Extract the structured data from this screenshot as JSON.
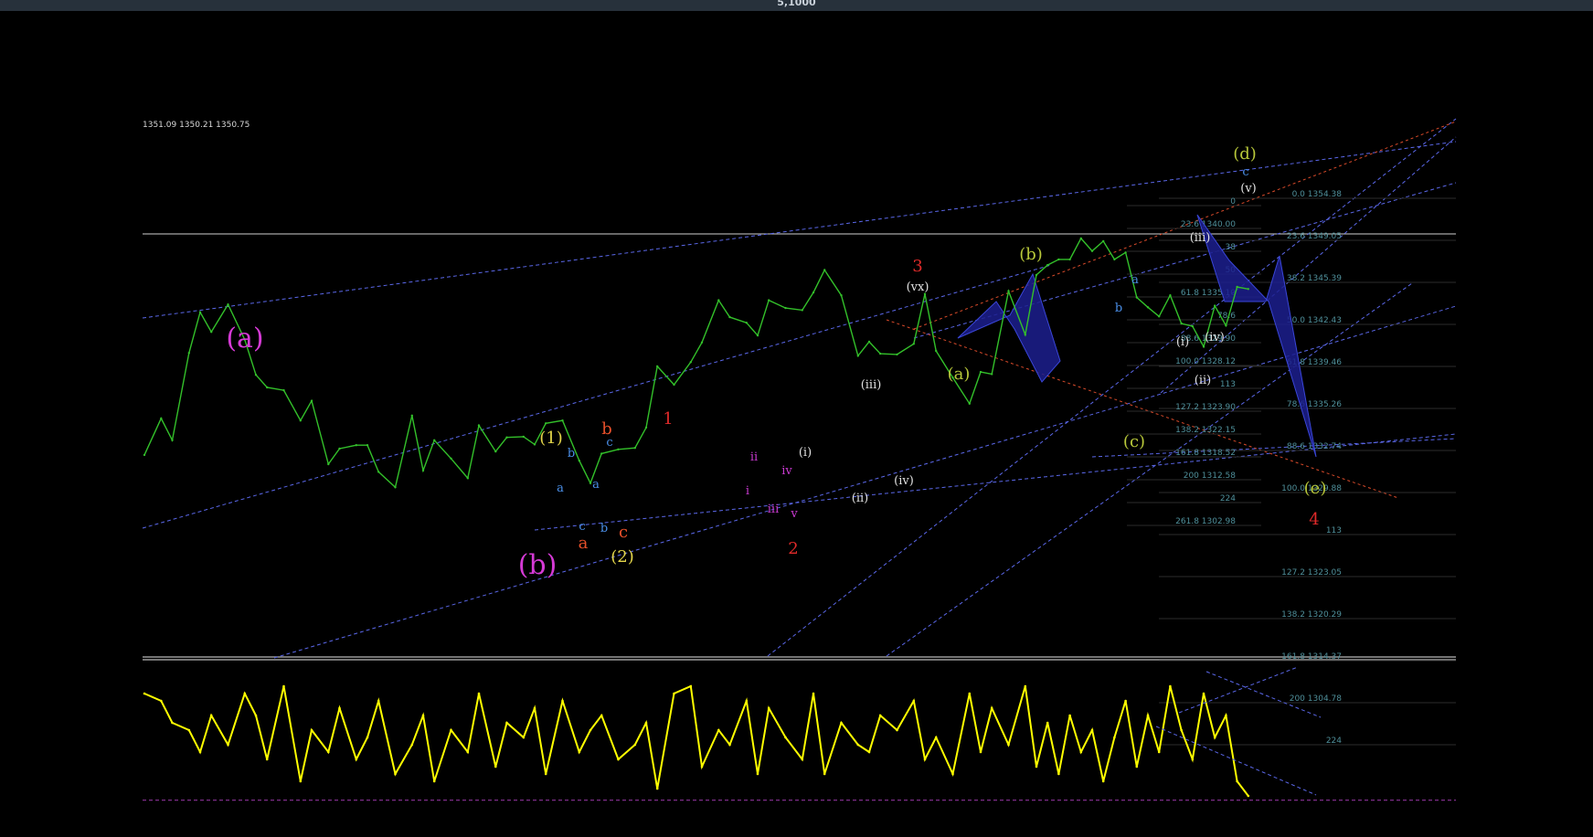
{
  "window": {
    "title": "5,1000"
  },
  "chart_data": [
    {
      "type": "line",
      "title": "",
      "ohlc_readout": "1351.09 1350.21 1350.75",
      "colors": {
        "price": "#33c02a",
        "background": "#000000",
        "channel": "#5a67e8",
        "fib_label": "#4f8f9a"
      },
      "x_index_range": [
        0,
        200
      ],
      "ylim": [
        1296,
        1372
      ],
      "series": [
        {
          "x": [
            0,
            3,
            5,
            8,
            10,
            12,
            15,
            18,
            20,
            22,
            25,
            28,
            30,
            33,
            35,
            38,
            40,
            42,
            45,
            48,
            50,
            52,
            55,
            58,
            60,
            63,
            65,
            68,
            70,
            72,
            75,
            78,
            80,
            82,
            85,
            88,
            90,
            92,
            95,
            98,
            100,
            103,
            105,
            108,
            110,
            112,
            115,
            118,
            120,
            122,
            125,
            128,
            130,
            132,
            135,
            138,
            140,
            142,
            145,
            148,
            150,
            152,
            155,
            158,
            160,
            162,
            164,
            166,
            168,
            170,
            172,
            174,
            176,
            178,
            180,
            182,
            184,
            186,
            188,
            190,
            192,
            194,
            196,
            198
          ],
          "values": [
            1324.2,
            1329.4,
            1326.3,
            1338.7,
            1344.5,
            1341.7,
            1345.6,
            1340.6,
            1335.6,
            1333.8,
            1333.4,
            1329.1,
            1331.9,
            1322.9,
            1325.1,
            1325.6,
            1325.6,
            1321.8,
            1319.6,
            1329.8,
            1322.0,
            1326.3,
            1323.7,
            1320.9,
            1328.4,
            1324.7,
            1326.7,
            1326.8,
            1325.7,
            1328.7,
            1329.1,
            1323.4,
            1320.2,
            1324.4,
            1325.0,
            1325.2,
            1328.1,
            1336.8,
            1334.2,
            1337.4,
            1340.2,
            1346.2,
            1343.8,
            1343.0,
            1341.2,
            1346.2,
            1345.1,
            1344.8,
            1347.3,
            1350.5,
            1346.9,
            1338.3,
            1340.3,
            1338.6,
            1338.5,
            1340.0,
            1347.1,
            1339.0,
            1335.2,
            1331.5,
            1336.0,
            1335.7,
            1347.5,
            1341.3,
            1349.8,
            1351.2,
            1352.0,
            1352.0,
            1355.0,
            1353.2,
            1354.6,
            1352.0,
            1353.0,
            1346.6,
            1345.2,
            1343.9,
            1346.9,
            1342.9,
            1342.5,
            1339.6,
            1345.4,
            1342.6,
            1348.1,
            1347.8
          ]
        }
      ],
      "fib_levels": [
        "0.0 1354.38",
        "23.6 1349.05",
        "38.2 1345.39",
        "50.0 1342.43",
        "61.8 1339.46",
        "78.6 1335.26",
        "88.6 1332.74",
        "100.0 1329.88",
        "113",
        "127.2 1323.05",
        "138.2 1320.29",
        "161.8 1314.37",
        "200 1304.78",
        "224",
        "0",
        "23.6 1340.00",
        "38",
        "50",
        "61.8 1335.10",
        "78.6",
        "88.6 1329.90",
        "100.0 1328.12",
        "113",
        "127.2 1323.90",
        "138.2 1322.15",
        "161.8 1318.52",
        "200 1312.58",
        "224",
        "261.8 1302.98"
      ],
      "wave_labels": [
        "(a)",
        "(b)",
        "(1)",
        "(2)",
        "a",
        "b",
        "c",
        "a",
        "b",
        "c",
        "a",
        "b",
        "c",
        "1",
        "2",
        "3",
        "4",
        "i",
        "ii",
        "iii",
        "iv",
        "v",
        "(i)",
        "(ii)",
        "(iii)",
        "(iv)",
        "(vx)",
        "(a)",
        "(b)",
        "(c)",
        "(d)",
        "(e)",
        "(i)",
        "(ii)",
        "(iii)",
        "(iv)",
        "(v)",
        "a",
        "b",
        "c"
      ]
    },
    {
      "type": "line",
      "title": "",
      "ylim": [
        0,
        100
      ],
      "reference_line": 12,
      "colors": {
        "line": "#ffff00",
        "reference": "#a03ab0"
      },
      "series": [
        {
          "x": [
            0,
            3,
            5,
            8,
            10,
            12,
            15,
            18,
            20,
            22,
            25,
            28,
            30,
            33,
            35,
            38,
            40,
            42,
            45,
            48,
            50,
            52,
            55,
            58,
            60,
            63,
            65,
            68,
            70,
            72,
            75,
            78,
            80,
            82,
            85,
            88,
            90,
            92,
            95,
            98,
            100,
            103,
            105,
            108,
            110,
            112,
            115,
            118,
            120,
            122,
            125,
            128,
            130,
            132,
            135,
            138,
            140,
            142,
            145,
            148,
            150,
            152,
            155,
            158,
            160,
            162,
            164,
            166,
            168,
            170,
            172,
            174,
            176,
            178,
            180,
            182,
            184,
            186,
            188,
            190,
            192,
            194,
            196,
            198
          ],
          "values": [
            85,
            80,
            65,
            60,
            45,
            70,
            50,
            85,
            70,
            40,
            90,
            25,
            60,
            45,
            75,
            40,
            55,
            80,
            30,
            50,
            70,
            25,
            60,
            45,
            85,
            35,
            65,
            55,
            75,
            30,
            80,
            45,
            60,
            70,
            40,
            50,
            65,
            20,
            85,
            90,
            35,
            60,
            50,
            80,
            30,
            75,
            55,
            40,
            85,
            30,
            65,
            50,
            45,
            70,
            60,
            80,
            40,
            55,
            30,
            85,
            45,
            75,
            50,
            90,
            35,
            65,
            30,
            70,
            45,
            60,
            25,
            55,
            80,
            35,
            70,
            45,
            90,
            60,
            40,
            85,
            55,
            70,
            25,
            15
          ]
        }
      ]
    }
  ]
}
